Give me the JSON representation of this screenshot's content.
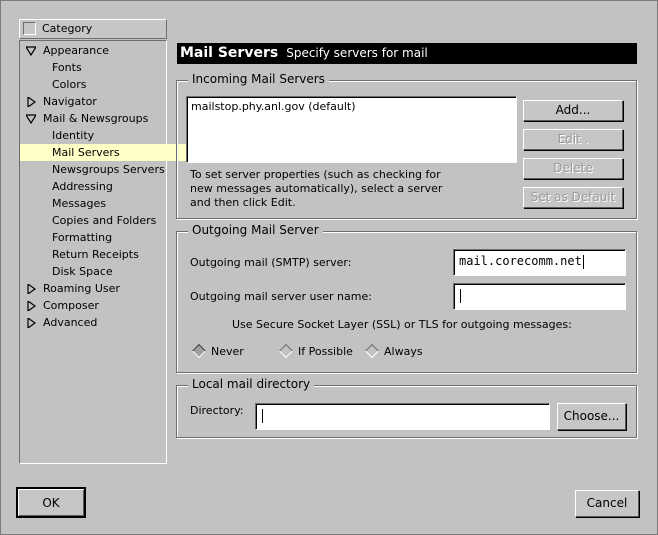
{
  "sidebar": {
    "header": "Category",
    "items": [
      {
        "label": "Appearance",
        "level": 0,
        "expanded": true
      },
      {
        "label": "Fonts",
        "level": 1
      },
      {
        "label": "Colors",
        "level": 1
      },
      {
        "label": "Navigator",
        "level": 0,
        "expanded": false
      },
      {
        "label": "Mail & Newsgroups",
        "level": 0,
        "expanded": true
      },
      {
        "label": "Identity",
        "level": 1
      },
      {
        "label": "Mail Servers",
        "level": 1,
        "selected": true
      },
      {
        "label": "Newsgroups Servers",
        "level": 1
      },
      {
        "label": "Addressing",
        "level": 1
      },
      {
        "label": "Messages",
        "level": 1
      },
      {
        "label": "Copies and Folders",
        "level": 1
      },
      {
        "label": "Formatting",
        "level": 1
      },
      {
        "label": "Return Receipts",
        "level": 1
      },
      {
        "label": "Disk Space",
        "level": 1
      },
      {
        "label": "Roaming User",
        "level": 0,
        "expanded": false
      },
      {
        "label": "Composer",
        "level": 0,
        "expanded": false
      },
      {
        "label": "Advanced",
        "level": 0,
        "expanded": false
      }
    ]
  },
  "banner": {
    "title": "Mail Servers",
    "subtitle": "Specify servers for mail"
  },
  "incoming": {
    "legend": "Incoming Mail Servers",
    "servers": [
      "mailstop.phy.anl.gov (default)"
    ],
    "help_line1": "To set server properties (such as checking for",
    "help_line2": "new messages automatically), select a server",
    "help_line3": "and then click Edit.",
    "add_label": "Add...",
    "edit_label": "Edit .",
    "delete_label": "Delete",
    "default_label": "Set as Default"
  },
  "outgoing": {
    "legend": "Outgoing Mail Server",
    "smtp_label": "Outgoing mail (SMTP) server:",
    "smtp_value": "mail.corecomm.net",
    "user_label": "Outgoing mail server user name:",
    "user_value": "",
    "ssl_label": "Use Secure Socket Layer (SSL) or TLS for outgoing messages:",
    "radio_never": "Never",
    "radio_if_possible": "If Possible",
    "radio_always": "Always",
    "selected": "Never"
  },
  "local": {
    "legend": "Local mail directory",
    "dir_label": "Directory:",
    "dir_value": "",
    "choose_label": "Choose..."
  },
  "footer": {
    "ok_label": "OK",
    "cancel_label": "Cancel"
  }
}
